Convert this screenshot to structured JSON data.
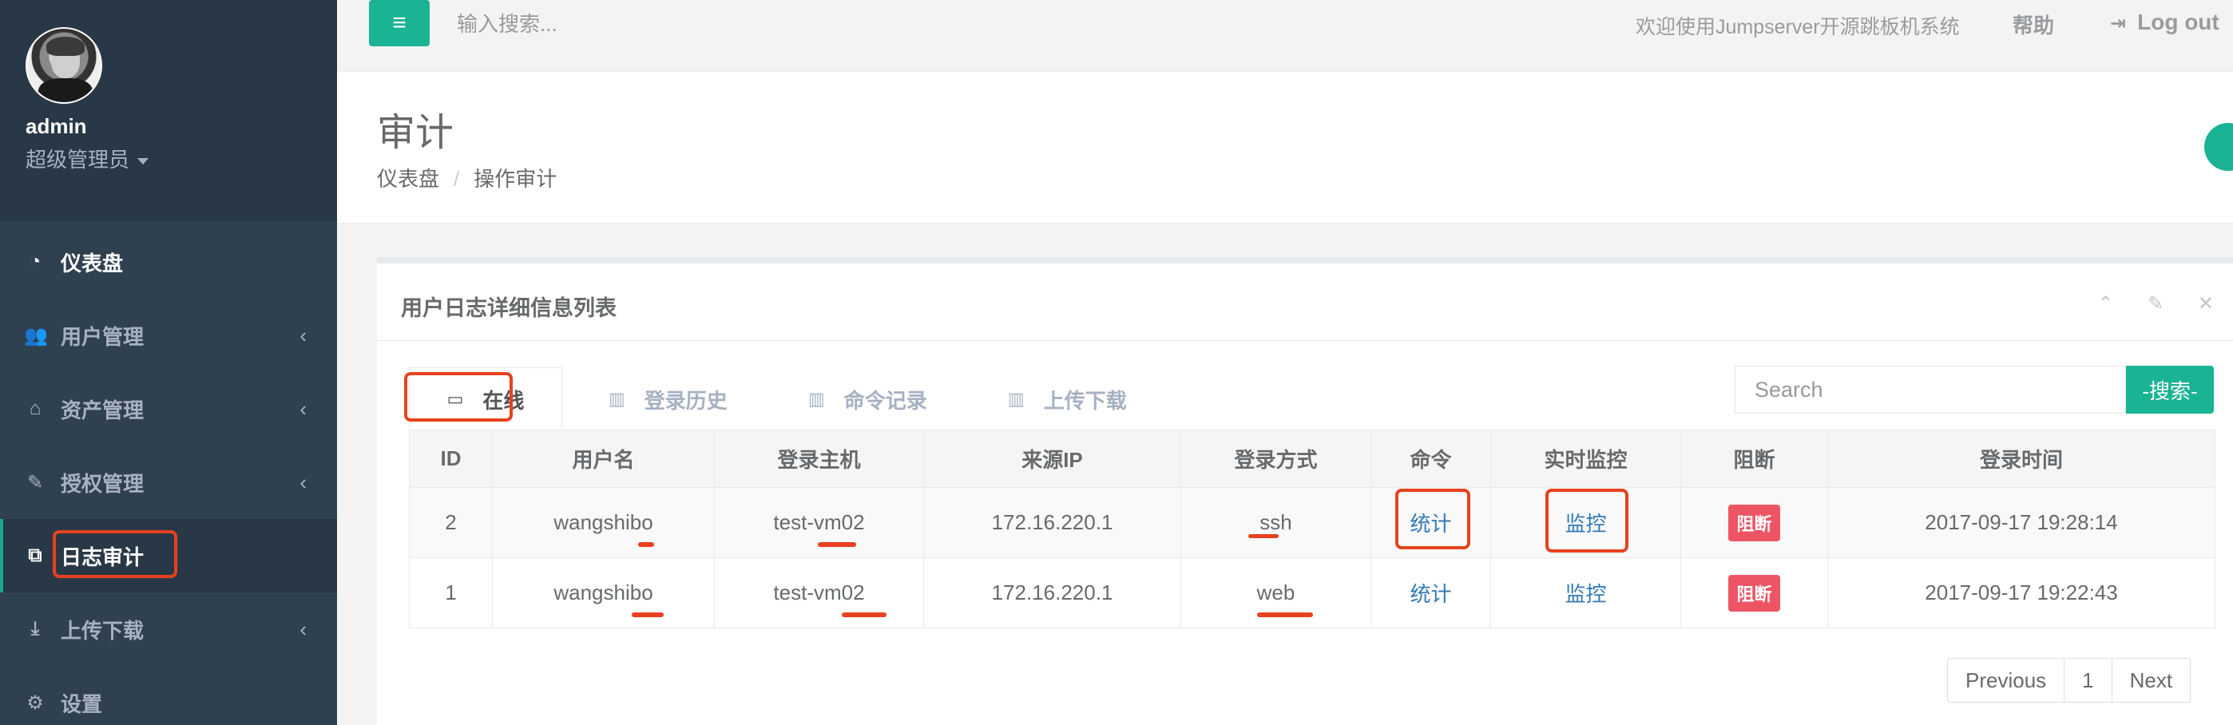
{
  "sidebar": {
    "profile": {
      "name": "admin",
      "role": "超级管理员"
    },
    "items": [
      {
        "label": "仪表盘",
        "icon": "dashboard-icon",
        "glyph": "◔",
        "chevron": ""
      },
      {
        "label": "用户管理",
        "icon": "users-icon",
        "glyph": "👥",
        "chevron": "‹"
      },
      {
        "label": "资产管理",
        "icon": "inbox-icon",
        "glyph": "⌂",
        "chevron": "‹"
      },
      {
        "label": "授权管理",
        "icon": "edit-icon",
        "glyph": "✎",
        "chevron": "‹"
      },
      {
        "label": "日志审计",
        "icon": "copy-icon",
        "glyph": "⧉",
        "chevron": ""
      },
      {
        "label": "上传下载",
        "icon": "download-icon",
        "glyph": "⤓",
        "chevron": "‹"
      },
      {
        "label": "设置",
        "icon": "gears-icon",
        "glyph": "⚙",
        "chevron": ""
      }
    ]
  },
  "topbar": {
    "menu_glyph": "≡",
    "search_placeholder": "输入搜索...",
    "welcome": "欢迎使用Jumpserver开源跳板机系统",
    "help": "帮助",
    "logout_glyph": "⇥",
    "logout": "Log out"
  },
  "header": {
    "title": "审计",
    "breadcrumb": [
      "仪表盘",
      "/",
      "操作审计"
    ]
  },
  "panel": {
    "title": "用户日志详细信息列表",
    "tools": "⌃ ✎ ✕",
    "tabs": [
      {
        "label": "在线",
        "glyph": "▭"
      },
      {
        "label": "登录历史",
        "glyph": "▥"
      },
      {
        "label": "命令记录",
        "glyph": "▥"
      },
      {
        "label": "上传下载",
        "glyph": "▥"
      }
    ],
    "search_placeholder": "Search",
    "search_button": "-搜索-",
    "columns": [
      "ID",
      "用户名",
      "登录主机",
      "来源IP",
      "登录方式",
      "命令",
      "实时监控",
      "阻断",
      "登录时间"
    ],
    "rows": [
      {
        "id": "2",
        "user": "wangshibo",
        "host": "test-vm02",
        "ip": "172.16.220.1",
        "method": "ssh",
        "cmd": "统计",
        "monitor": "监控",
        "block": "阻断",
        "time": "2017-09-17 19:28:14"
      },
      {
        "id": "1",
        "user": "wangshibo",
        "host": "test-vm02",
        "ip": "172.16.220.1",
        "method": "web",
        "cmd": "统计",
        "monitor": "监控",
        "block": "阻断",
        "time": "2017-09-17 19:22:43"
      }
    ],
    "pagination": {
      "prev": "Previous",
      "page": "1",
      "next": "Next"
    }
  },
  "colors": {
    "sidebar": "#2f4050",
    "accent": "#1ab394",
    "danger": "#ed5565",
    "annotation": "#e8411f",
    "link": "#337ab7"
  }
}
